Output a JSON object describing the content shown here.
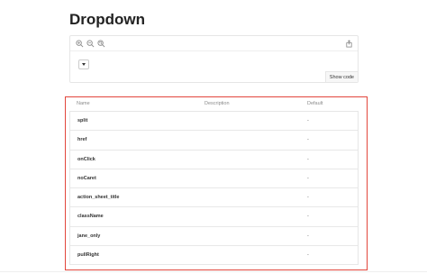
{
  "page": {
    "title": "Dropdown"
  },
  "preview": {
    "toolbar": [
      {
        "icon": "zoom-in-icon"
      },
      {
        "icon": "zoom-out-icon"
      },
      {
        "icon": "reset-zoom-icon"
      },
      {
        "icon": "share-icon"
      }
    ],
    "show_code_label": "Show code"
  },
  "props_table": {
    "columns": [
      "Name",
      "Description",
      "Default"
    ],
    "rows": [
      {
        "name": "split",
        "description": "",
        "default": "-"
      },
      {
        "name": "href",
        "description": "",
        "default": "-"
      },
      {
        "name": "onClick",
        "description": "",
        "default": "-"
      },
      {
        "name": "noCaret",
        "description": "",
        "default": "-"
      },
      {
        "name": "action_sheet_title",
        "description": "",
        "default": "-"
      },
      {
        "name": "className",
        "description": "",
        "default": "-"
      },
      {
        "name": "jane_only",
        "description": "",
        "default": "-"
      },
      {
        "name": "pullRight",
        "description": "",
        "default": "-"
      }
    ]
  },
  "colors": {
    "highlight_border": "#e2463c",
    "title_text": "#222222",
    "header_text": "#8a8a8a"
  }
}
